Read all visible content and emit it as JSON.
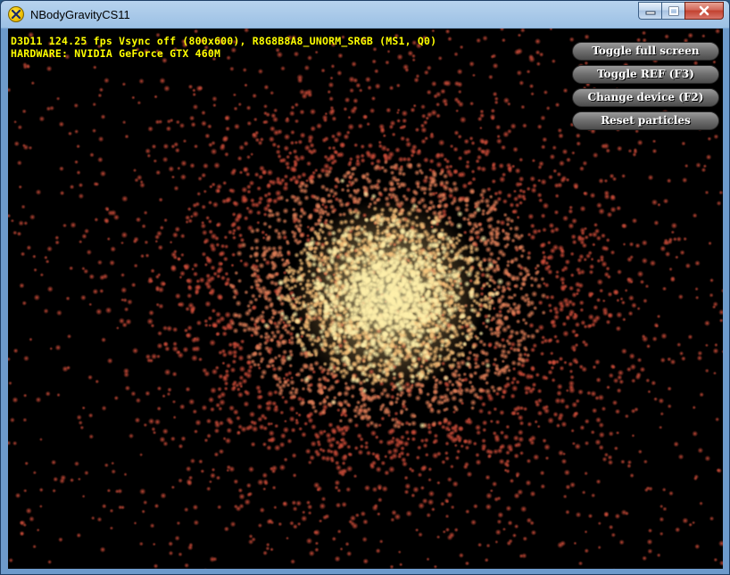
{
  "window": {
    "title": "NBodyGravityCS11",
    "icon": "directx-x-icon",
    "controls": [
      "minimize-icon",
      "maximize-icon",
      "close-icon"
    ]
  },
  "hud": {
    "line1": "D3D11 124.25 fps Vsync off (800x600), R8G8B8A8_UNORM_SRGB (MS1, Q0)",
    "line2": "HARDWARE: NVIDIA GeForce GTX 460M",
    "color": "#ffff00"
  },
  "buttons": [
    {
      "label": "Toggle full screen"
    },
    {
      "label": "Toggle REF (F3)"
    },
    {
      "label": "Change device (F2)"
    },
    {
      "label": "Reset particles"
    }
  ],
  "scene": {
    "background": "#000000",
    "core_color": "#fff3a6",
    "particle_color": "#e0604a"
  }
}
